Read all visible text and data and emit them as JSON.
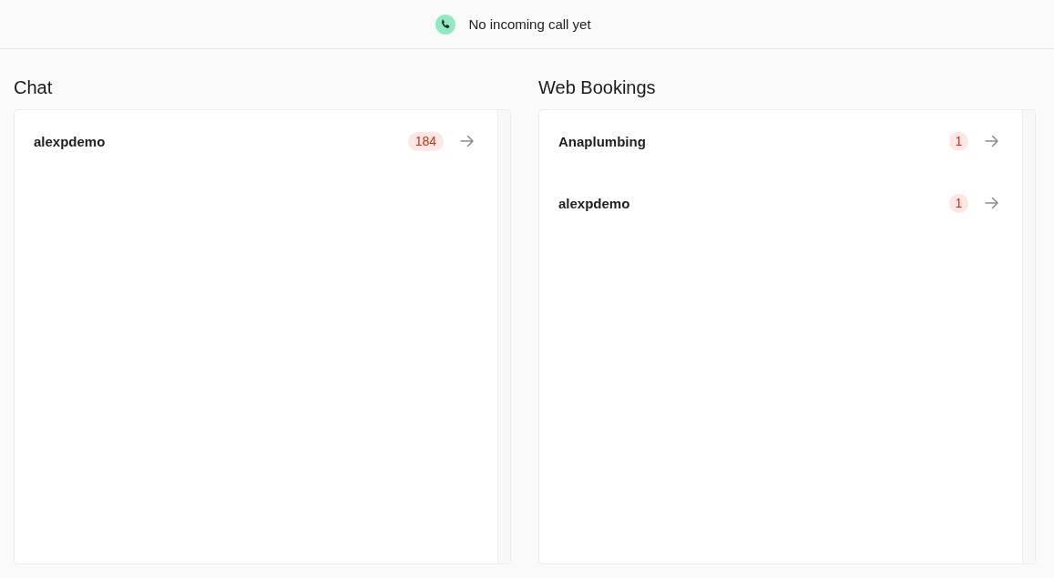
{
  "call_status": {
    "text": "No incoming call yet"
  },
  "sections": [
    {
      "title": "Chat",
      "items": [
        {
          "name": "alexpdemo",
          "count": "184"
        }
      ]
    },
    {
      "title": "Web Bookings",
      "items": [
        {
          "name": "Anaplumbing",
          "count": "1"
        },
        {
          "name": "alexpdemo",
          "count": "1"
        }
      ]
    }
  ]
}
